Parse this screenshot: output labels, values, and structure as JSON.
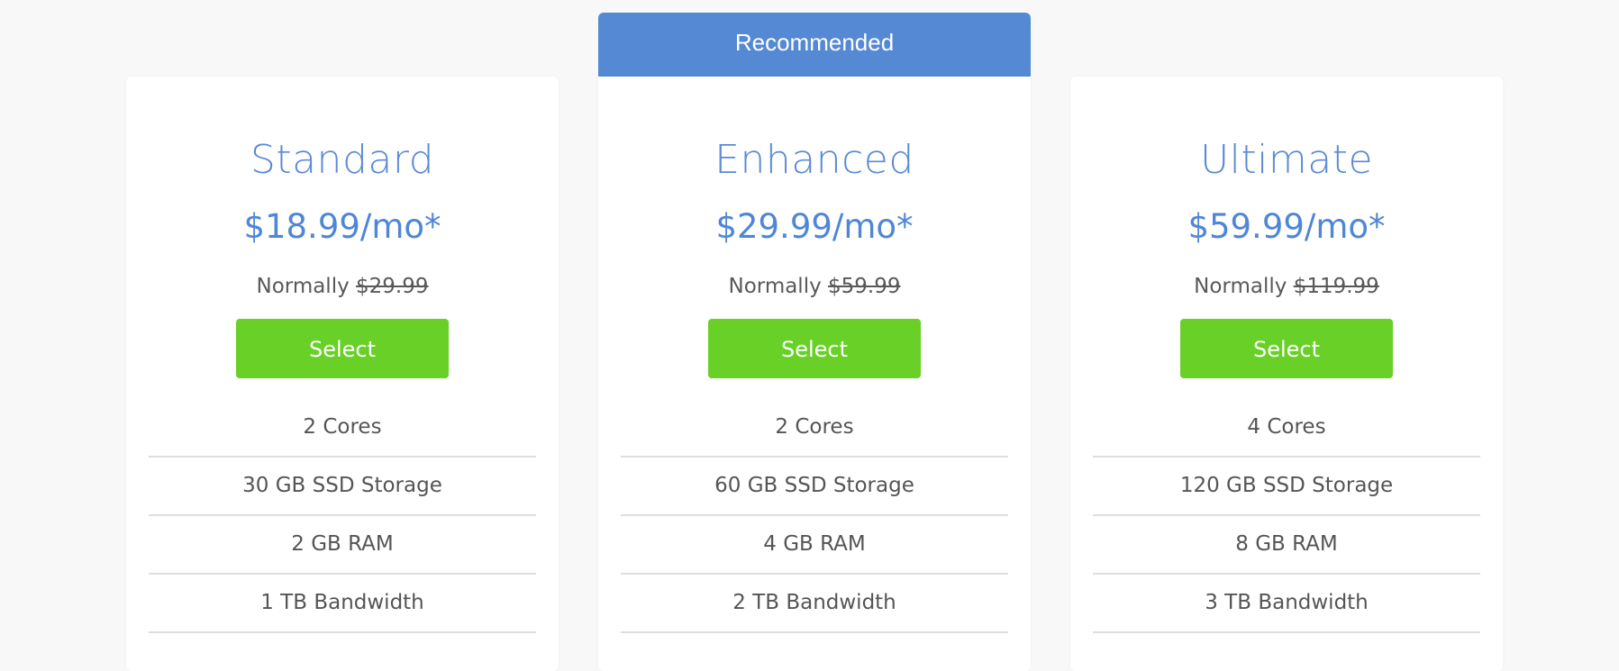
{
  "recommended_label": "Recommended",
  "plans": [
    {
      "name": "Standard",
      "price": "$18.99/mo*",
      "normally_label": "Normally",
      "old_price": "$29.99",
      "button_label": "Select",
      "features": [
        "2 Cores",
        "30 GB SSD Storage",
        "2 GB RAM",
        "1 TB Bandwidth"
      ]
    },
    {
      "name": "Enhanced",
      "price": "$29.99/mo*",
      "normally_label": "Normally",
      "old_price": "$59.99",
      "button_label": "Select",
      "features": [
        "2 Cores",
        "60 GB SSD Storage",
        "4 GB RAM",
        "2 TB Bandwidth"
      ]
    },
    {
      "name": "Ultimate",
      "price": "$59.99/mo*",
      "normally_label": "Normally",
      "old_price": "$119.99",
      "button_label": "Select",
      "features": [
        "4 Cores",
        "120 GB SSD Storage",
        "8 GB RAM",
        "3 TB Bandwidth"
      ]
    }
  ],
  "colors": {
    "accent_blue": "#5589d4",
    "select_green": "#69d028",
    "background": "#f8f8f8"
  }
}
